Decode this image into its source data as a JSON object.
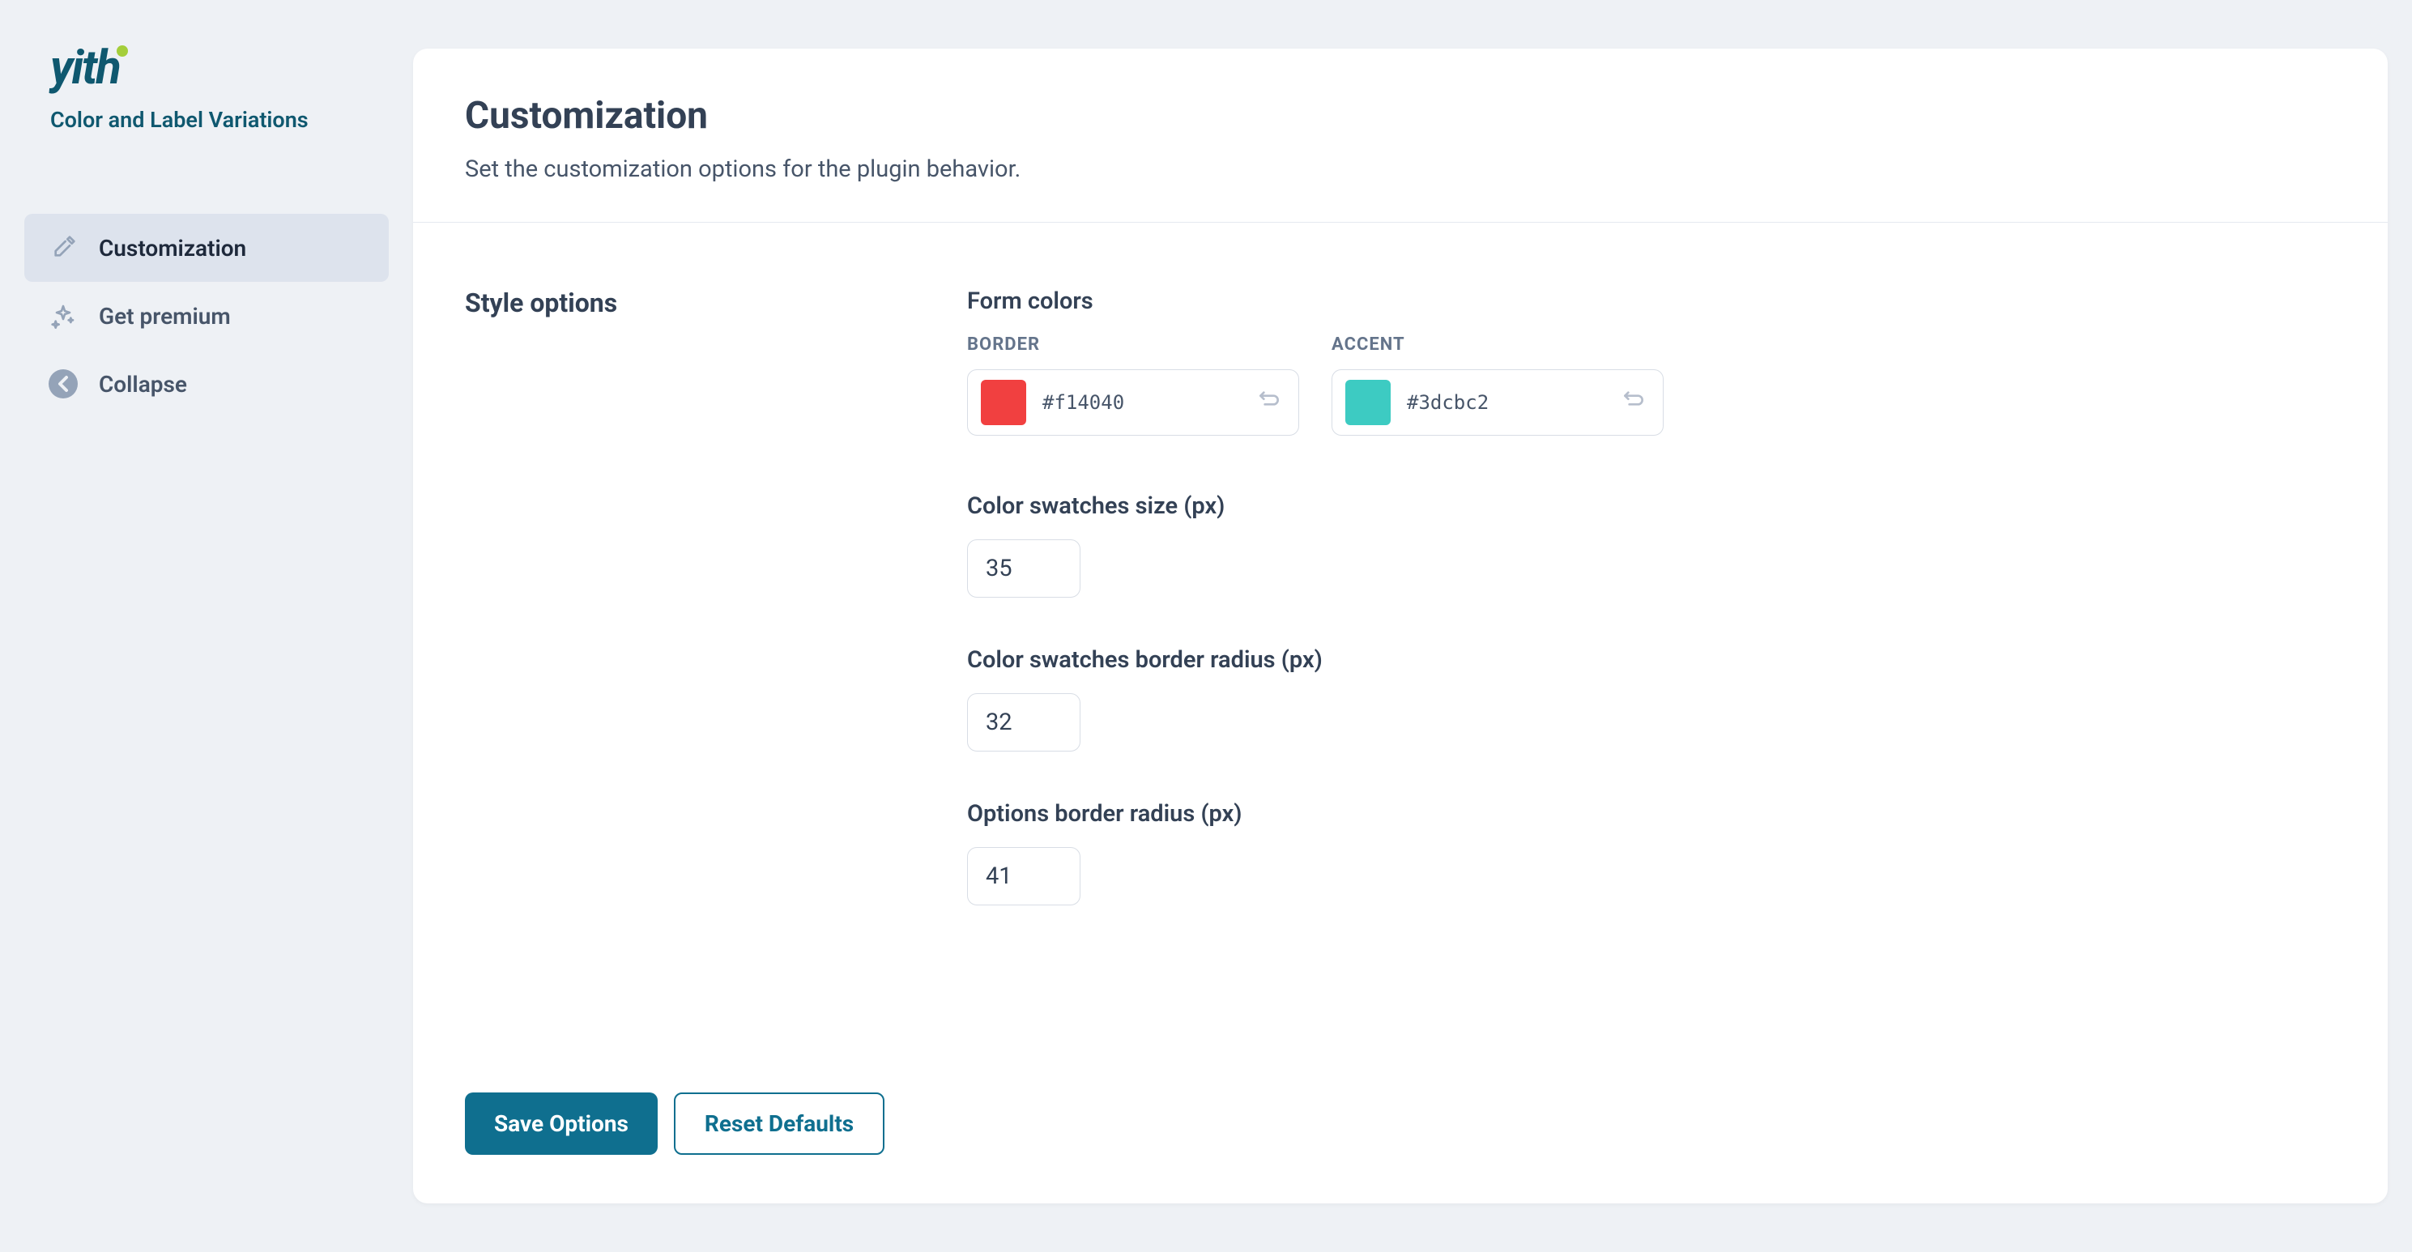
{
  "brand": {
    "logo_text": "yith",
    "plugin_name": "Color and Label Variations"
  },
  "sidebar": {
    "items": [
      {
        "label": "Customization",
        "icon": "eyedropper",
        "active": true
      },
      {
        "label": "Get premium",
        "icon": "sparkles",
        "active": false
      },
      {
        "label": "Collapse",
        "icon": "arrow-left-circle",
        "active": false
      }
    ]
  },
  "header": {
    "title": "Customization",
    "description": "Set the customization options for the plugin behavior."
  },
  "section": {
    "title": "Style options"
  },
  "form": {
    "form_colors_label": "Form colors",
    "border": {
      "label": "BORDER",
      "hex": "#f14040",
      "color": "#f14040"
    },
    "accent": {
      "label": "ACCENT",
      "hex": "#3dcbc2",
      "color": "#3dcbc2"
    },
    "swatch_size": {
      "label": "Color swatches size (px)",
      "value": "35"
    },
    "swatch_radius": {
      "label": "Color swatches border radius (px)",
      "value": "32"
    },
    "options_radius": {
      "label": "Options border radius (px)",
      "value": "41"
    }
  },
  "footer": {
    "save": "Save Options",
    "reset": "Reset Defaults"
  }
}
